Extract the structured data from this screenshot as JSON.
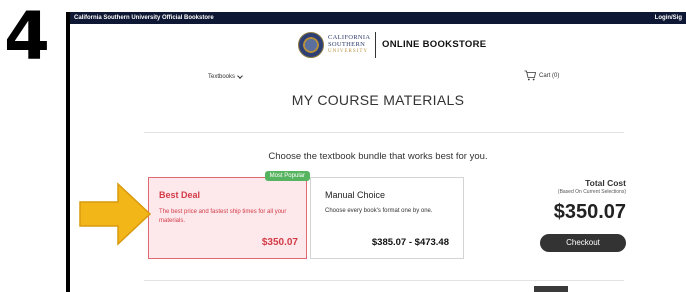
{
  "step_label": "4",
  "topbar": {
    "site_name": "California Southern University Official Bookstore",
    "login_label": "Login/Sig"
  },
  "logo": {
    "line1": "CALIFORNIA",
    "line2": "SOUTHERN",
    "line3": "UNIVERSITY",
    "store_name": "ONLINE BOOKSTORE"
  },
  "nav": {
    "textbooks_label": "Textbooks",
    "cart_label": "Cart (0)"
  },
  "page_title": "MY COURSE MATERIALS",
  "subtitle": "Choose the textbook bundle that works best for you.",
  "cards": {
    "best": {
      "badge": "Most Popular",
      "title": "Best Deal",
      "description": "The best price and fastest ship times for all your materials.",
      "price": "$350.07"
    },
    "manual": {
      "title": "Manual Choice",
      "description": "Choose every book's format one by one.",
      "price": "$385.07 - $473.48"
    }
  },
  "summary": {
    "label": "Total Cost",
    "sublabel": "(Based On Current Selections)",
    "amount": "$350.07",
    "checkout_label": "Checkout"
  },
  "colors": {
    "topbar": "#0e1733",
    "accent_red": "#d33a46",
    "badge_green": "#56b35f",
    "arrow_yellow": "#f2b619"
  },
  "icons": {
    "cart": "cart-icon",
    "chevron": "chevron-down-icon",
    "arrow": "arrow-right-icon"
  }
}
